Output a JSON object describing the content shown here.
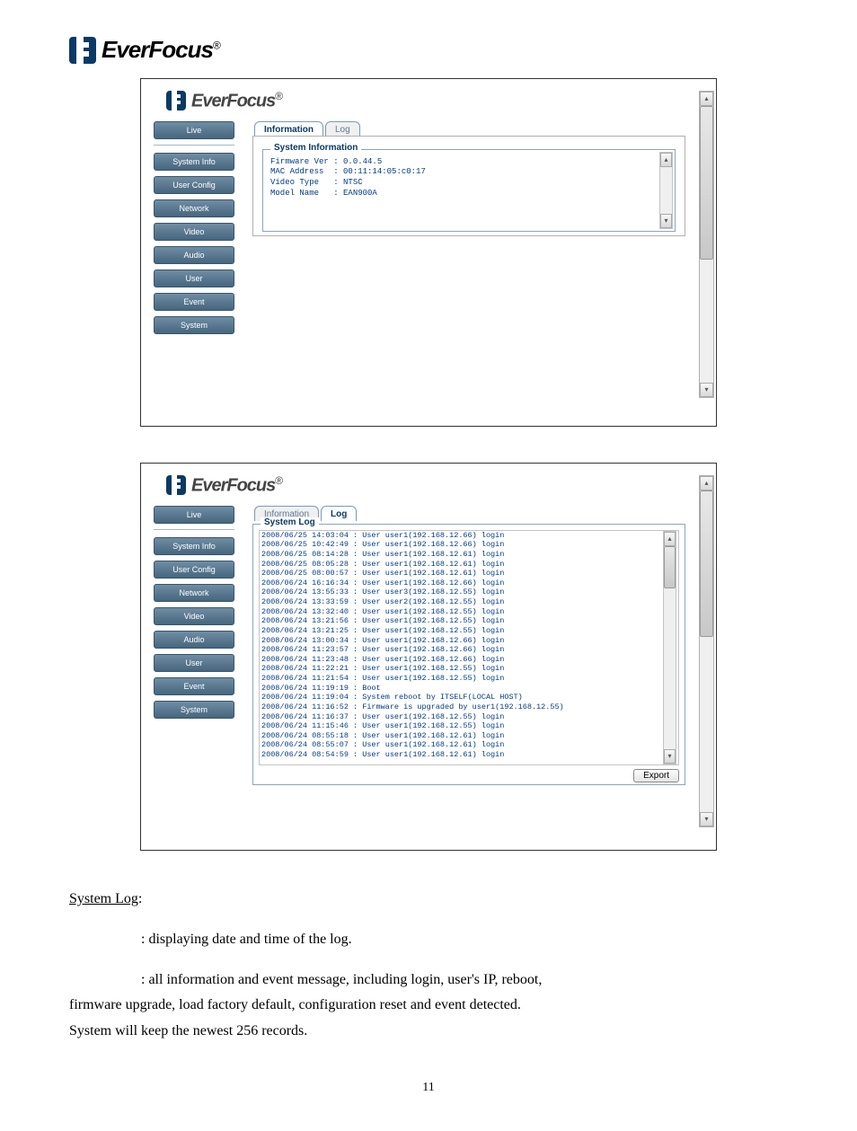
{
  "brand": "EverFocus",
  "registered": "®",
  "nav": {
    "live": "Live",
    "system_info": "System Info",
    "user_config": "User Config",
    "network": "Network",
    "video": "Video",
    "audio": "Audio",
    "user": "User",
    "event": "Event",
    "system": "System"
  },
  "tabs": {
    "information": "Information",
    "log": "Log"
  },
  "system_info_panel": {
    "legend": "System Information",
    "firmware_label": "Firmware Ver",
    "firmware_value": "0.0.44.5",
    "mac_label": "MAC Address",
    "mac_value": "00:11:14:05:c0:17",
    "video_type_label": "Video Type",
    "video_type_value": "NTSC",
    "model_label": "Model Name",
    "model_value": "EAN900A"
  },
  "log_panel": {
    "legend": "System Log",
    "entries": [
      "2008/06/25 14:03:04 : User user1(192.168.12.66) login",
      "2008/06/25 10:42:49 : User user1(192.168.12.66) login",
      "2008/06/25 08:14:28 : User user1(192.168.12.61) login",
      "2008/06/25 08:05:28 : User user1(192.168.12.61) login",
      "2008/06/25 08:00:57 : User user1(192.168.12.61) login",
      "2008/06/24 16:16:34 : User user1(192.168.12.66) login",
      "2008/06/24 13:55:33 : User user3(192.168.12.55) login",
      "2008/06/24 13:33:59 : User user2(192.168.12.55) login",
      "2008/06/24 13:32:40 : User user1(192.168.12.55) login",
      "2008/06/24 13:21:56 : User user1(192.168.12.55) login",
      "2008/06/24 13:21:25 : User user1(192.168.12.55) login",
      "2008/06/24 13:00:34 : User user1(192.168.12.66) login",
      "2008/06/24 11:23:57 : User user1(192.168.12.66) login",
      "2008/06/24 11:23:48 : User user1(192.168.12.66) login",
      "2008/06/24 11:22:21 : User user1(192.168.12.55) login",
      "2008/06/24 11:21:54 : User user1(192.168.12.55) login",
      "2008/06/24 11:19:19 : Boot",
      "2008/06/24 11:19:04 : System reboot by ITSELF(LOCAL HOST)",
      "2008/06/24 11:16:52 : Firmware is upgraded by user1(192.168.12.55)",
      "2008/06/24 11:16:37 : User user1(192.168.12.55) login",
      "2008/06/24 11:15:46 : User user1(192.168.12.55) login",
      "2008/06/24 08:55:18 : User user1(192.168.12.61) login",
      "2008/06/24 08:55:07 : User user1(192.168.12.61) login",
      "2008/06/24 08:54:59 : User user1(192.168.12.61) login"
    ],
    "export": "Export"
  },
  "body": {
    "heading": "System Log",
    "colon_after_heading": ":",
    "line1": ": displaying date and time of the log.",
    "line2": ": all information and event message, including login, user's IP, reboot,",
    "line3": "firmware upgrade, load factory default, configuration reset and event detected.",
    "line4": "System will keep the newest 256 records."
  },
  "page_number": "11"
}
